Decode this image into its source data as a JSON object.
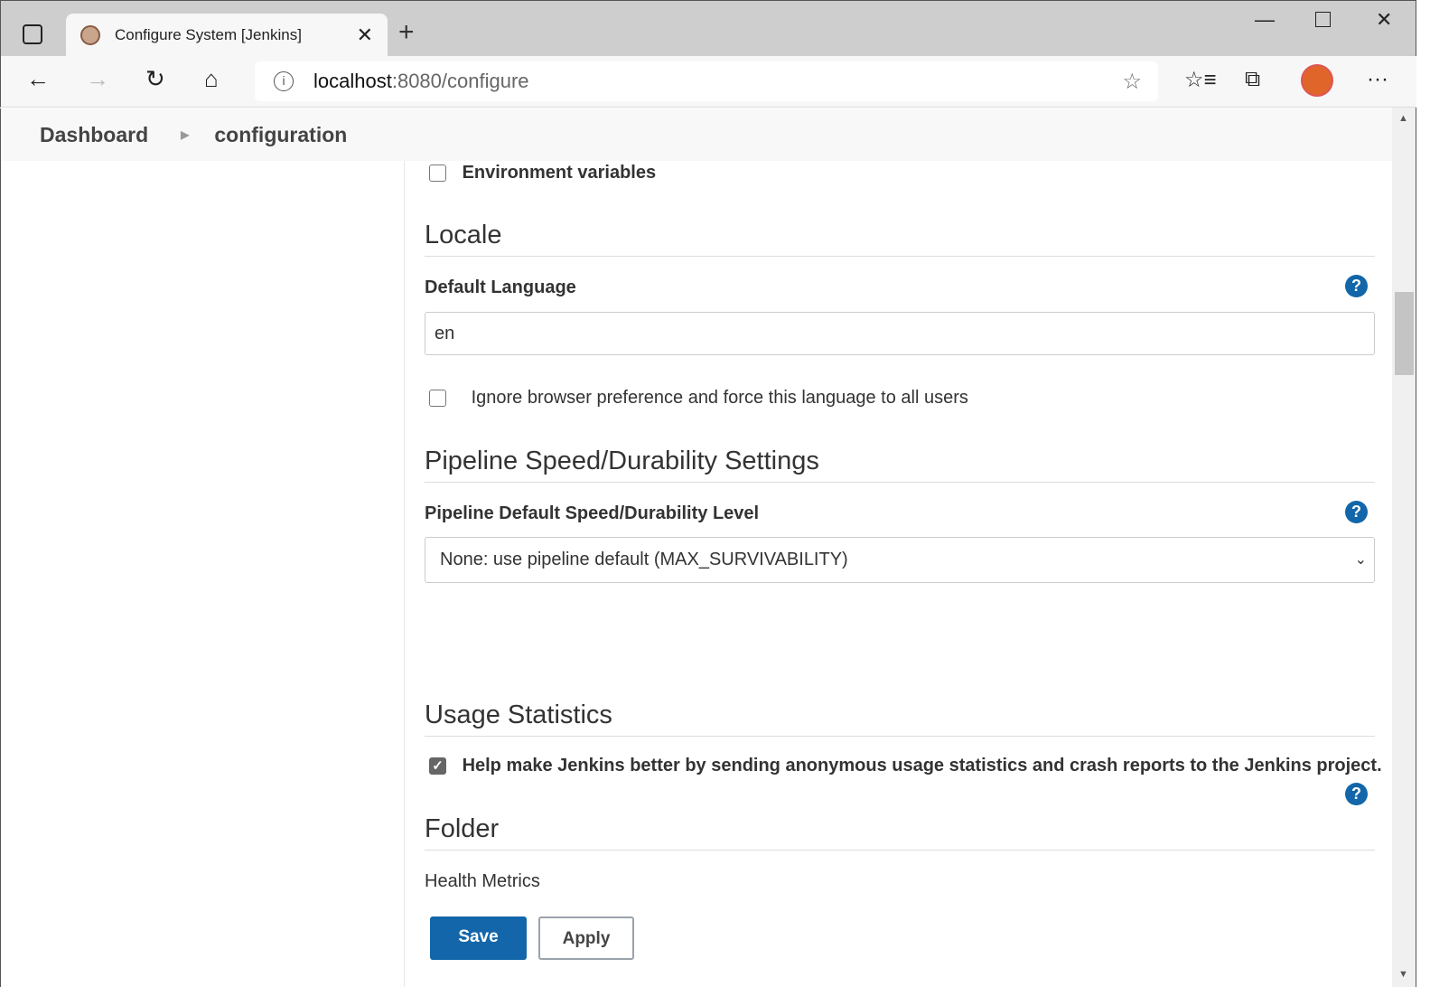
{
  "browser": {
    "tab_title": "Configure System [Jenkins]",
    "url_host": "localhost",
    "url_path": ":8080/configure"
  },
  "breadcrumb": [
    "Dashboard",
    "configuration"
  ],
  "env_vars": {
    "label": "Environment variables",
    "checked": false
  },
  "locale": {
    "heading": "Locale",
    "field_label": "Default Language",
    "value": "en",
    "ignore_label": "Ignore browser preference and force this language to all users",
    "ignore_checked": false
  },
  "pipeline": {
    "heading": "Pipeline Speed/Durability Settings",
    "field_label": "Pipeline Default Speed/Durability Level",
    "selected": "None: use pipeline default (MAX_SURVIVABILITY)"
  },
  "usage": {
    "heading": "Usage Statistics",
    "label": "Help make Jenkins better by sending anonymous usage statistics and crash reports to the Jenkins project.",
    "checked": true
  },
  "folder": {
    "heading": "Folder",
    "sub": "Health Metrics"
  },
  "buttons": {
    "save": "Save",
    "apply": "Apply"
  },
  "colors": {
    "primary": "#1266a9",
    "help": "#1266a9"
  }
}
